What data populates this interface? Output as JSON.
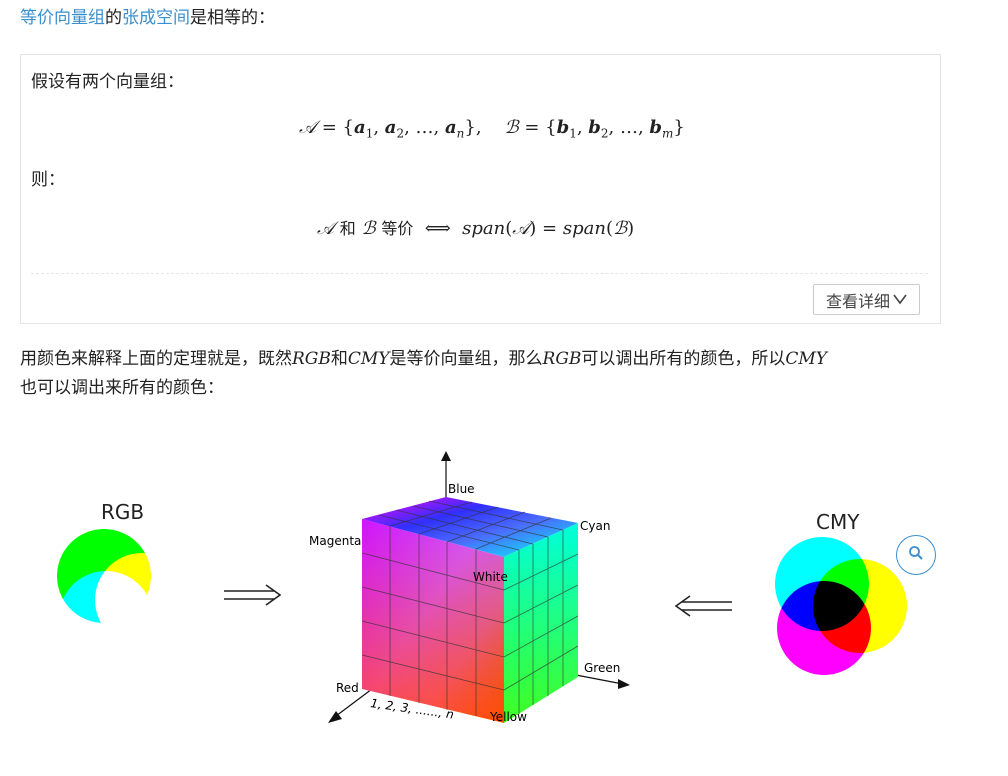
{
  "intro": {
    "link1": "等价向量组",
    "mid": "的",
    "link2": "张成空间",
    "tail": "是相等的："
  },
  "theorem": {
    "premise": "假设有两个向量组：",
    "then": "则：",
    "equiv_word": "和",
    "equiv_word2": "等价",
    "detail_button": "查看详细"
  },
  "paragraph": {
    "p1": "用颜色来解释上面的定理就是，既然",
    "rgb": "RGB",
    "p2": "和",
    "cmy": "CMY",
    "p3": "是等价向量组，那么",
    "rgb2": "RGB",
    "p4": "可以调出所有的颜色，所以",
    "cmy2": "CMY",
    "p5": "也可以调出来所有的颜色："
  },
  "figure": {
    "rgb_title": "RGB",
    "cmy_title": "CMY",
    "cube_labels": {
      "blue": "Blue",
      "cyan": "Cyan",
      "magenta": "Magenta",
      "white": "White",
      "green": "Green",
      "red": "Red",
      "yellow": "Yellow",
      "ticks": "1,   2,    3, ......,   n"
    },
    "colors": {
      "red": "#ff0000",
      "green": "#00ff00",
      "blue": "#0000ff",
      "cyan": "#00ffff",
      "magenta": "#ff00ff",
      "yellow": "#ffff00"
    }
  },
  "icons": {
    "zoom": "search-icon",
    "detail": "chevron-down-icon"
  }
}
